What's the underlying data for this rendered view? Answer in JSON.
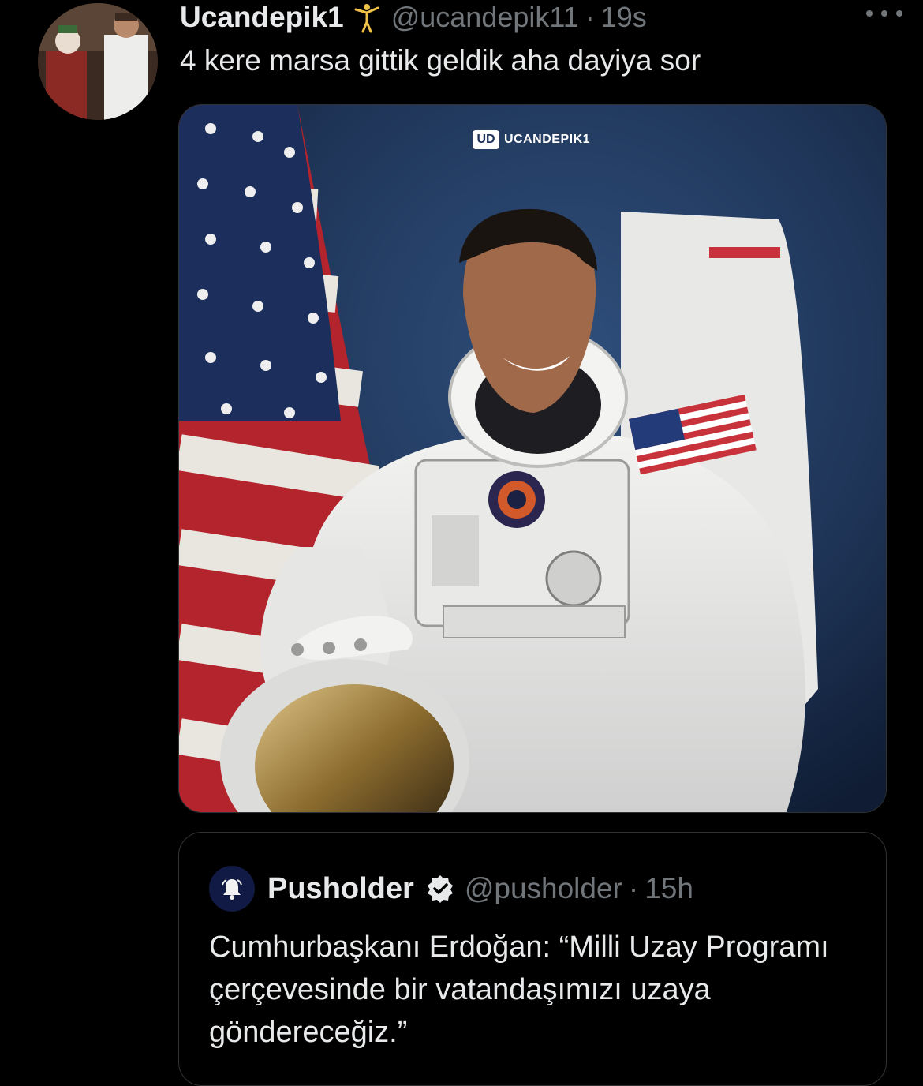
{
  "tweet": {
    "author_name": "Ucandepik1",
    "author_handle": "@ucandepik11",
    "separator": "·",
    "time": "19s",
    "text": "4 kere marsa gittik geldik aha dayiya sor",
    "avatar_icon": "joker-avatar",
    "more_icon": "more-horizontal-icon",
    "media": {
      "watermark_badge": "UD",
      "watermark_text": "UCANDEPIK1",
      "description_icon": "astronaut-photo"
    }
  },
  "quoted_tweet": {
    "author_name": "Pusholder",
    "author_handle": "@pusholder",
    "separator": "·",
    "time": "15h",
    "text": "Cumhurbaşkanı Erdoğan: “Milli Uzay Programı çerçevesinde bir vatandaşımızı uzaya göndereceğiz.”",
    "avatar_icon": "bell-icon",
    "verified_icon": "verified-badge-icon"
  },
  "colors": {
    "background": "#000000",
    "text_primary": "#e7e9ea",
    "text_secondary": "#71767b",
    "border": "#2f3336"
  }
}
